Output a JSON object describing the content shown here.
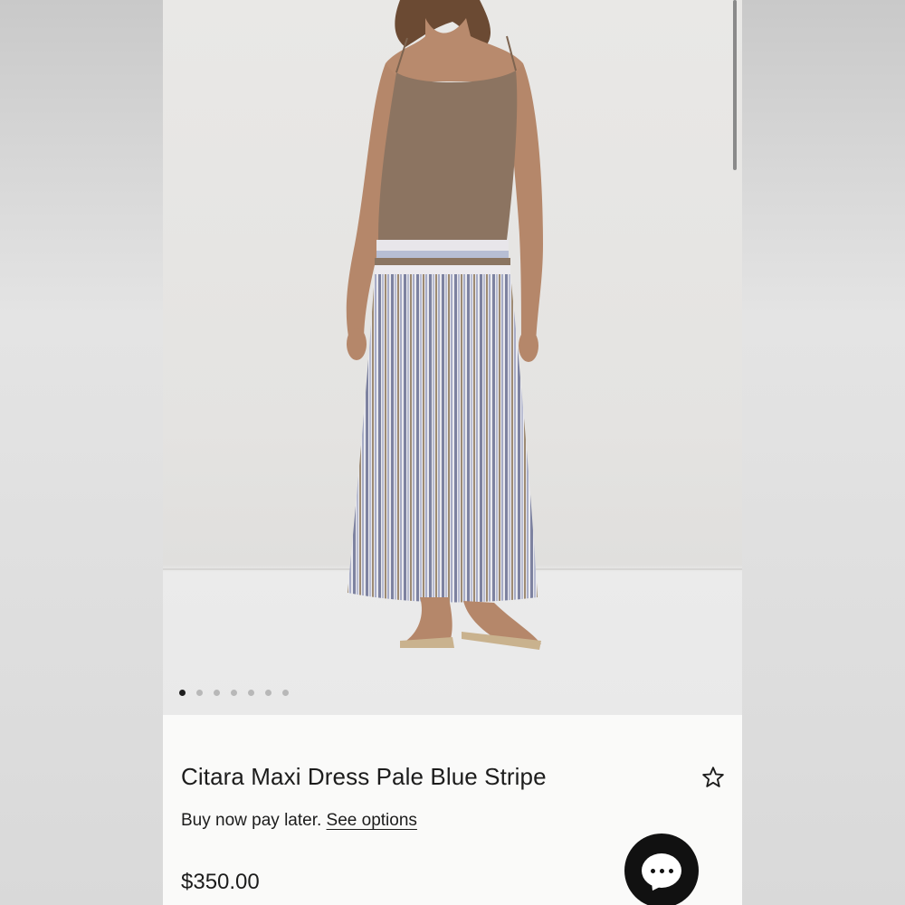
{
  "product": {
    "title": "Citara Maxi Dress Pale Blue Stripe",
    "bnpl_text": "Buy now pay later.",
    "bnpl_link": "See options",
    "price": "$350.00",
    "image_alt": "Model wearing brown knit top with striped pleated maxi skirt"
  },
  "gallery": {
    "image_count": 7,
    "active_index": 0
  },
  "icons": {
    "favorite": "star-icon",
    "chat": "chat-bubble-icon"
  },
  "colors": {
    "page_bg": "#fafaf9",
    "text": "#1c1c1c",
    "chat_button": "#111111",
    "dot_active": "#1e1e1e",
    "dot_inactive": "#b8b8b8"
  }
}
